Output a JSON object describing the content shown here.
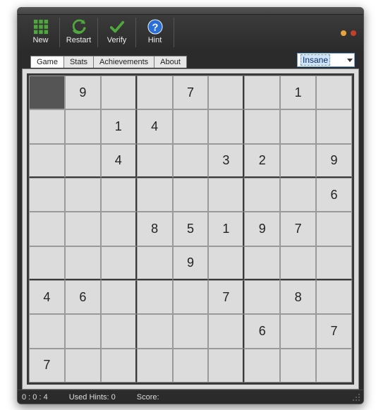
{
  "toolbar": {
    "new_label": "New",
    "restart_label": "Restart",
    "verify_label": "Verify",
    "hint_label": "Hint"
  },
  "tabs": {
    "items": [
      {
        "label": "Game",
        "active": true
      },
      {
        "label": "Stats",
        "active": false
      },
      {
        "label": "Achievements",
        "active": false
      },
      {
        "label": "About",
        "active": false
      }
    ]
  },
  "difficulty": {
    "selected": "Insane"
  },
  "board": {
    "selected_cell": 0,
    "cells": [
      "",
      "9",
      "",
      "",
      "7",
      "",
      "",
      "1",
      "",
      "",
      "",
      "1",
      "4",
      "",
      "",
      "",
      "",
      "",
      "",
      "",
      "4",
      "",
      "",
      "3",
      "2",
      "",
      "9",
      "",
      "",
      "",
      "",
      "",
      "",
      "",
      "",
      "6",
      "",
      "",
      "",
      "8",
      "5",
      "1",
      "9",
      "7",
      "",
      "",
      "",
      "",
      "",
      "9",
      "",
      "",
      "",
      "",
      "4",
      "6",
      "",
      "",
      "",
      "7",
      "",
      "8",
      "",
      "",
      "",
      "",
      "",
      "",
      "",
      "6",
      "",
      "7",
      "7",
      "",
      "",
      "",
      "",
      "",
      "",
      "",
      ""
    ]
  },
  "status": {
    "time": "0 : 0 : 4",
    "hints_label": "Used Hints:",
    "hints_value": "0",
    "score_label": "Score:",
    "score_value": ""
  },
  "colors": {
    "accent_orange": "#e8a33a",
    "accent_red": "#c5402a",
    "board_border": "#3a3a3a"
  }
}
